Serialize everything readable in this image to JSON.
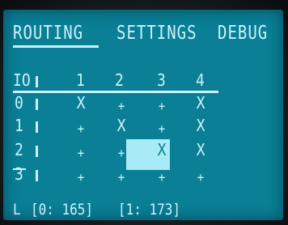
{
  "tabs": [
    {
      "label": "ROUTING",
      "active": true
    },
    {
      "label": "SETTINGS",
      "active": false
    },
    {
      "label": "DEBUG",
      "active": false
    }
  ],
  "matrix": {
    "corner_label": "IO",
    "columns": [
      "1",
      "2",
      "3",
      "4"
    ],
    "rows": [
      {
        "label": "0",
        "cells": [
          "X",
          "+",
          "+",
          "X"
        ]
      },
      {
        "label": "1",
        "cells": [
          "+",
          "X",
          "+",
          "X"
        ]
      },
      {
        "label": "2",
        "cells": [
          "+",
          "+",
          "X",
          "X"
        ]
      },
      {
        "label": "3",
        "cells": [
          "+",
          "+",
          "+",
          "+"
        ]
      }
    ],
    "selected_row": 2,
    "selected_col": 2
  },
  "footer": {
    "prefix": "L",
    "readout_0": "[0: 165]",
    "readout_1": "[1: 173]"
  },
  "colors": {
    "screen_bg": "#0a7f96",
    "foreground": "#c9f3fb",
    "highlight": "#a8eaf5"
  }
}
